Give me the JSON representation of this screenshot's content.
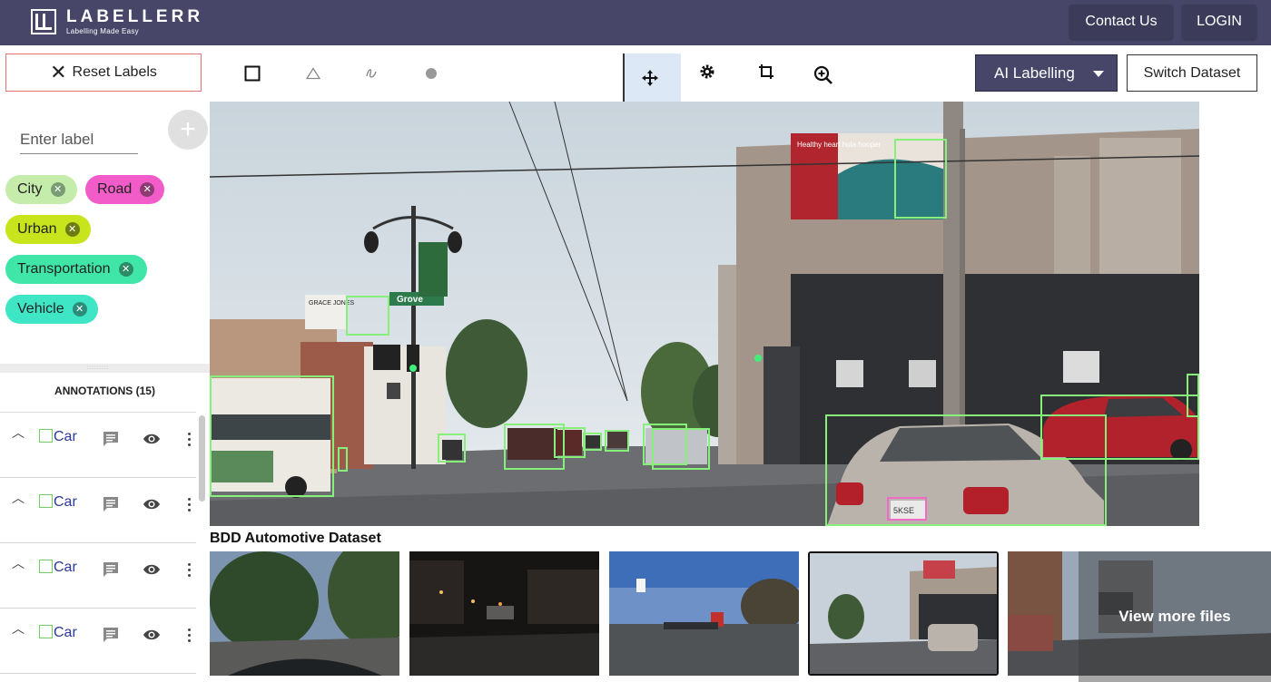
{
  "header": {
    "brand_name": "LABELLERR",
    "brand_tagline": "Labelling Made Easy",
    "contact_label": "Contact Us",
    "login_label": "LOGIN"
  },
  "toolbar": {
    "reset_label": "Reset Labels",
    "tools": [
      "rectangle-tool",
      "polygon-tool",
      "freehand-tool",
      "point-tool",
      "move-tool",
      "settings-tool",
      "crop-tool",
      "zoom-tool"
    ],
    "active_tool": "move-tool",
    "ai_label": "AI Labelling",
    "switch_label": "Switch Dataset"
  },
  "labels": {
    "input_placeholder": "Enter label",
    "chips": [
      {
        "name": "City",
        "color": "#c6ecab"
      },
      {
        "name": "Road",
        "color": "#f25cc8"
      },
      {
        "name": "Urban",
        "color": "#c7e41d"
      },
      {
        "name": "Transportation",
        "color": "#3fe6a8"
      },
      {
        "name": "Vehicle",
        "color": "#3fe6c6"
      }
    ]
  },
  "annotations": {
    "header": "ANNOTATIONS (15)",
    "items": [
      {
        "label": "Car"
      },
      {
        "label": "Car"
      },
      {
        "label": "Car"
      },
      {
        "label": "Car"
      }
    ]
  },
  "image": {
    "billboard_text": "Healthy heart hula hooper",
    "street_sign": "Grove",
    "storefront_sign": "GRACE JONES",
    "bbox_color": "#86f07a",
    "plate_box_color": "#f06ac8",
    "plate_text": "5KSE"
  },
  "dataset": {
    "title": "BDD Automotive Dataset",
    "view_more": "View more files",
    "thumbnails": [
      "forest-road-day",
      "city-street-night",
      "highway-dusk",
      "intersection-selected",
      "urban-street-snow"
    ]
  }
}
